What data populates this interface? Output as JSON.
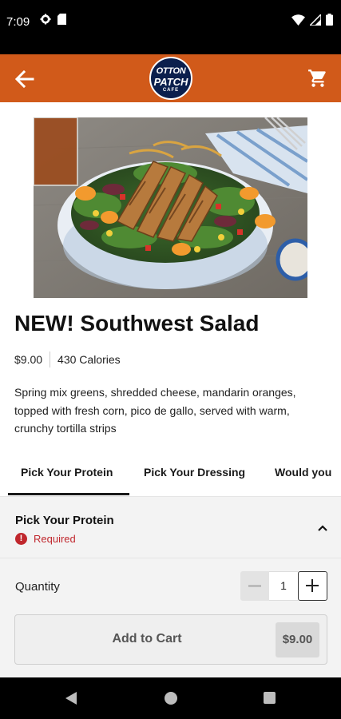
{
  "status_bar": {
    "time": "7:09",
    "icons": [
      "gear-icon",
      "sd-card-icon",
      "wifi-icon",
      "signal-icon",
      "battery-icon"
    ]
  },
  "app_bar": {
    "logo_line1": "OTTON",
    "logo_line2": "PATCH",
    "logo_line3": "CAFE",
    "back_icon": "arrow-left-icon",
    "cart_icon": "cart-icon",
    "background": "#d15a1a"
  },
  "product": {
    "title": "NEW! Southwest Salad",
    "price": "$9.00",
    "calories": "430 Calories",
    "description": "Spring mix greens, shredded cheese, mandarin oranges, topped with fresh corn, pico de gallo, served with warm, crunchy tortilla strips"
  },
  "tabs": [
    {
      "label": "Pick Your Protein",
      "active": true
    },
    {
      "label": "Pick Your Dressing",
      "active": false
    },
    {
      "label": "Would you",
      "active": false
    }
  ],
  "section": {
    "title": "Pick Your Protein",
    "required_label": "Required",
    "expanded": true
  },
  "order": {
    "quantity_label": "Quantity",
    "quantity": "1",
    "add_label": "Add to Cart",
    "add_price": "$9.00"
  },
  "colors": {
    "accent": "#d15a1a",
    "logo": "#0b1f4d",
    "required": "#c0272d"
  }
}
